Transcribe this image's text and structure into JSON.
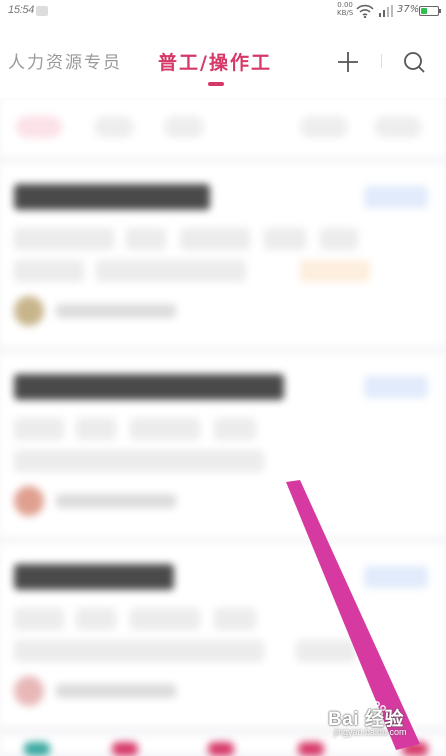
{
  "status_bar": {
    "time": "15:54",
    "network_speed": "0.00",
    "network_unit": "KB/S",
    "battery_percent": "37%",
    "battery_level": 0.37
  },
  "header": {
    "tabs": [
      {
        "label": "人力资源专员",
        "active": false
      },
      {
        "label": "普工/操作工",
        "active": true
      }
    ]
  },
  "watermark": {
    "brand": "Bai 经验",
    "sub": "jingyan.baidu.com"
  },
  "colors": {
    "accent": "#d63868",
    "arrow": "#d63aa0"
  },
  "icons": [
    "plus-icon",
    "search-icon",
    "wifi-icon",
    "signal-icon",
    "battery-icon",
    "paw-icon"
  ]
}
